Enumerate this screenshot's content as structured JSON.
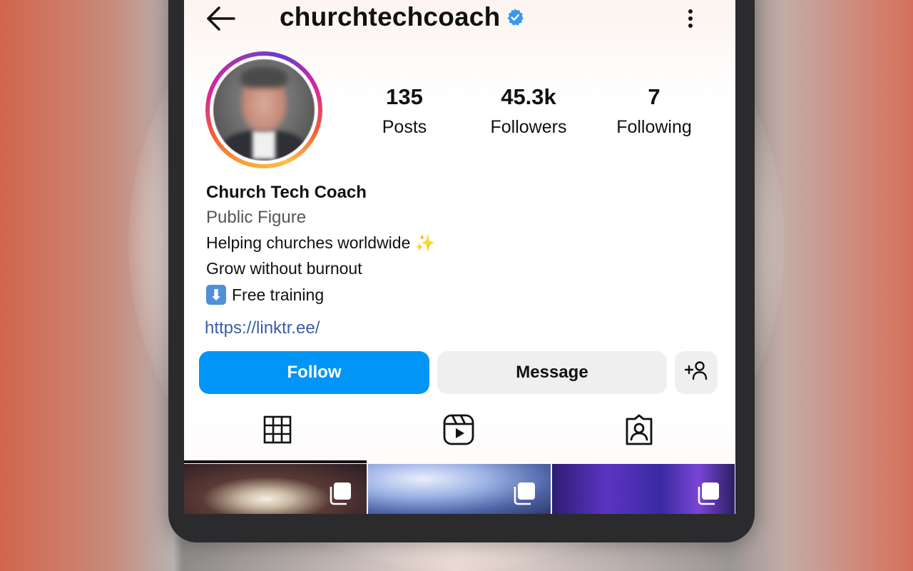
{
  "header": {
    "username": "churchtechcoach",
    "back_icon": "arrow-left-icon",
    "verified_icon": "verified-badge-icon",
    "more_icon": "more-vertical-icon",
    "verified_color": "#3897f0"
  },
  "stats": {
    "posts": {
      "value": "135",
      "label": "Posts"
    },
    "followers": {
      "value": "45.3k",
      "label": "Followers"
    },
    "following": {
      "value": "7",
      "label": "Following"
    }
  },
  "bio": {
    "name": "Church Tech Coach",
    "category": "Public Figure",
    "line1": "Helping churches worldwide",
    "line1_emoji": "✨",
    "line2": "Grow without burnout",
    "line3_emoji": "⬇",
    "line3": "Free training",
    "link": "https://linktr.ee/"
  },
  "actions": {
    "follow_label": "Follow",
    "message_label": "Message",
    "add_user_icon": "add-person-icon",
    "follow_color": "#0095f6"
  },
  "tabs": [
    {
      "name": "grid",
      "icon": "grid-icon",
      "active": true
    },
    {
      "name": "reels",
      "icon": "reels-icon",
      "active": false
    },
    {
      "name": "tagged",
      "icon": "tagged-user-icon",
      "active": false
    }
  ],
  "posts_grid": [
    {
      "icon": "multiple-images-icon"
    },
    {
      "icon": "multiple-images-icon"
    },
    {
      "icon": "multiple-images-icon"
    }
  ]
}
